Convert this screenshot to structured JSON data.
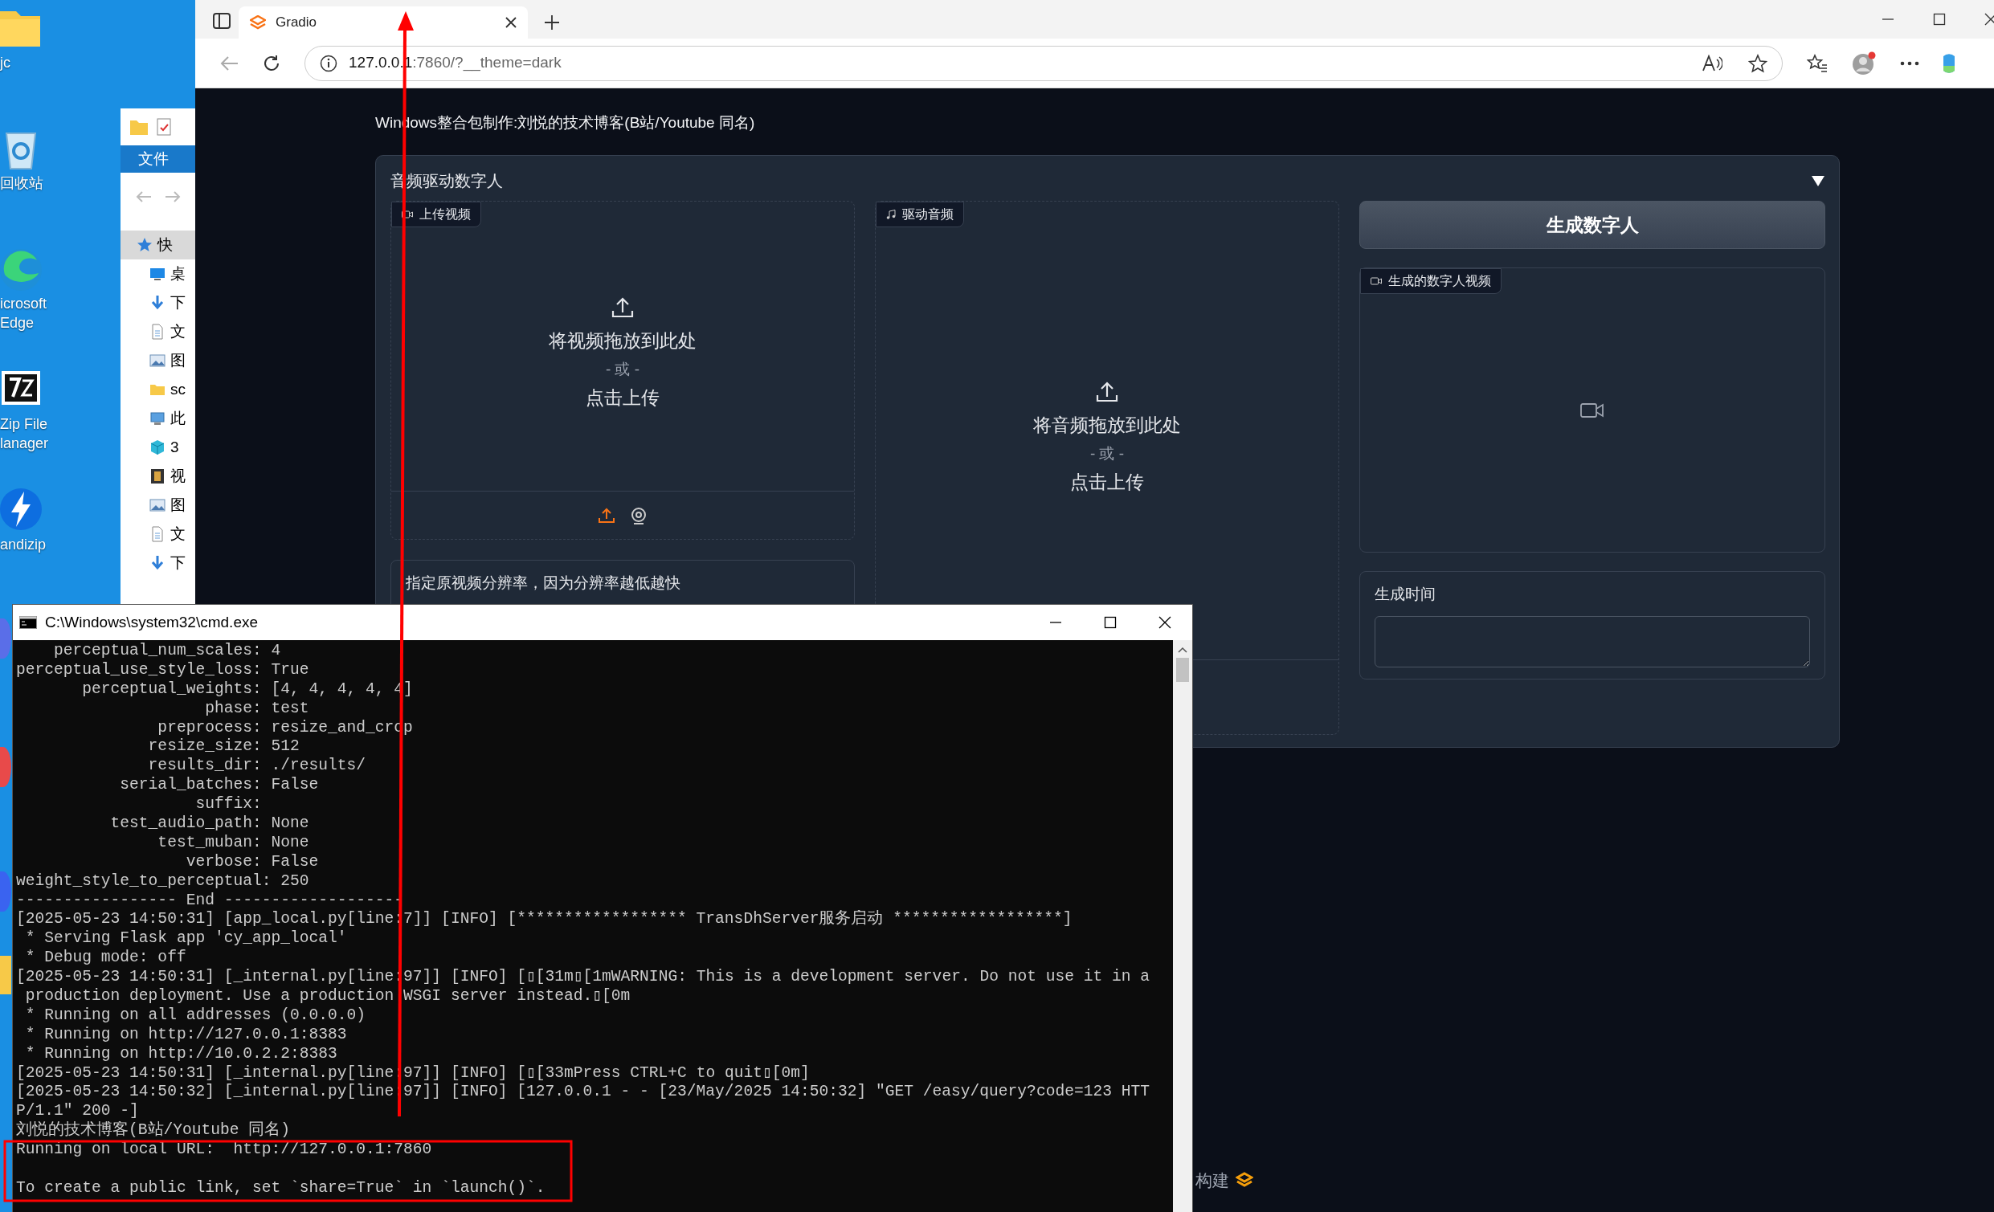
{
  "desktop": {
    "icons": [
      {
        "label": "jc",
        "kind": "folder"
      },
      {
        "label": "回收站",
        "kind": "recycle"
      },
      {
        "label": "icrosoft\nEdge",
        "kind": "edge"
      },
      {
        "label": "Zip File\nlanager",
        "kind": "sevenzip"
      },
      {
        "label": "andizip",
        "kind": "bandizip"
      }
    ]
  },
  "explorer": {
    "ribbon_tab": "文件",
    "nav_items": [
      {
        "label": "快",
        "kind": "star",
        "selected": true
      },
      {
        "label": "桌",
        "kind": "desktop",
        "selected": false
      },
      {
        "label": "下",
        "kind": "download",
        "selected": false
      },
      {
        "label": "文",
        "kind": "document",
        "selected": false
      },
      {
        "label": "图",
        "kind": "picture",
        "selected": false
      },
      {
        "label": "sc",
        "kind": "folder",
        "selected": false
      },
      {
        "label": "此",
        "kind": "computer",
        "selected": false
      },
      {
        "label": "3",
        "kind": "cube",
        "selected": false
      },
      {
        "label": "视",
        "kind": "film",
        "selected": false
      },
      {
        "label": "图",
        "kind": "picture",
        "selected": false
      },
      {
        "label": "文",
        "kind": "document",
        "selected": false
      },
      {
        "label": "下",
        "kind": "download",
        "selected": false
      }
    ]
  },
  "browser": {
    "tab": {
      "title": "Gradio"
    },
    "address": {
      "host": "127.0.0.1",
      "rest": ":7860/?__theme=dark"
    },
    "page": {
      "header": "Windows整合包制作:刘悦的技术博客(B站/Youtube 同名)",
      "accordion": {
        "title": "音频驱动数字人",
        "expanded": true
      },
      "video_input": {
        "label": "上传视频",
        "drop_text": "将视频拖放到此处",
        "or_text": "- 或 -",
        "click_text": "点击上传"
      },
      "resolution": {
        "label": "指定原视频分辨率，因为分辨率越低越快"
      },
      "audio_input": {
        "label": "驱动音频",
        "drop_text": "将音频拖放到此处",
        "or_text": "- 或 -",
        "click_text": "点击上传"
      },
      "generate_button": "生成数字人",
      "video_output": {
        "label": "生成的数字人视频"
      },
      "time_field": {
        "label": "生成时间"
      },
      "footer": "构建"
    }
  },
  "terminal": {
    "title": "C:\\Windows\\system32\\cmd.exe",
    "blocks": [
      {
        "lines": [
          "    perceptual_num_scales: 4",
          "perceptual_use_style_loss: True",
          "       perceptual_weights: [4, 4, 4, 4, 4]",
          "                    phase: test",
          "               preprocess: resize_and_crop",
          "              resize_size: 512",
          "              results_dir: ./results/",
          "           serial_batches: False",
          "                   suffix:",
          "          test_audio_path: None",
          "               test_muban: None",
          "                  verbose: False",
          "weight_style_to_perceptual: 250",
          "----------------- End -------------------",
          "[2025-05-23 14:50:31] [app_local.py[line:7]] [INFO] [****************** TransDhServer服务启动 ******************]",
          " * Serving Flask app 'cy_app_local'",
          " * Debug mode: off",
          "[2025-05-23 14:50:31] [_internal.py[line:97]] [INFO] [▯[31m▯[1mWARNING: This is a development server. Do not use it in a",
          " production deployment. Use a production WSGI server instead.▯[0m",
          " * Running on all addresses (0.0.0.0)",
          " * Running on http://127.0.0.1:8383",
          " * Running on http://10.0.2.2:8383",
          "[2025-05-23 14:50:31] [_internal.py[line:97]] [INFO] [▯[33mPress CTRL+C to quit▯[0m]",
          "[2025-05-23 14:50:32] [_internal.py[line:97]] [INFO] [127.0.0.1 - - [23/May/2025 14:50:32] ″GET /easy/query?code=123 HTT",
          "P/1.1″ 200 -]",
          "刘悦的技术博客(B站/Youtube 同名)",
          "Running on local URL:  http://127.0.0.1:7860"
        ]
      },
      {
        "lines": [
          "To create a public link, set `share=True` in `launch()`."
        ]
      }
    ]
  }
}
